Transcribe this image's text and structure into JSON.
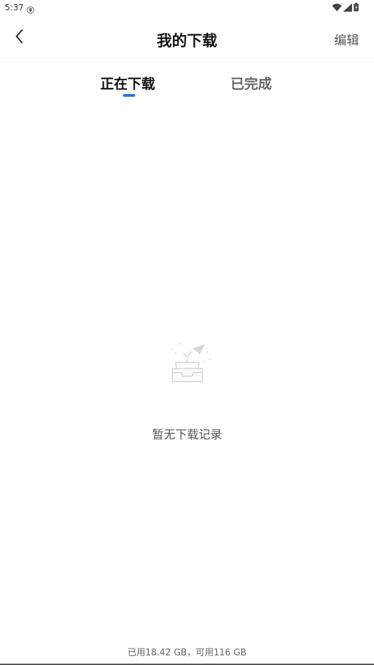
{
  "status_bar": {
    "time": "5:37",
    "icons": [
      "shield-icon",
      "wifi-icon",
      "signal-icon",
      "battery-icon"
    ]
  },
  "header": {
    "title": "我的下载",
    "edit_label": "编辑",
    "back_icon": "chevron-left-icon"
  },
  "tabs": [
    {
      "label": "正在下载",
      "active": true
    },
    {
      "label": "已完成",
      "active": false
    }
  ],
  "colors": {
    "accent": "#2b6fe6",
    "title_text": "#111111",
    "secondary_text": "#555555"
  },
  "empty_state": {
    "icon": "empty-inbox-icon",
    "message": "暂无下载记录"
  },
  "footer": {
    "storage_text": "已用18.42 GB，可用116 GB"
  }
}
